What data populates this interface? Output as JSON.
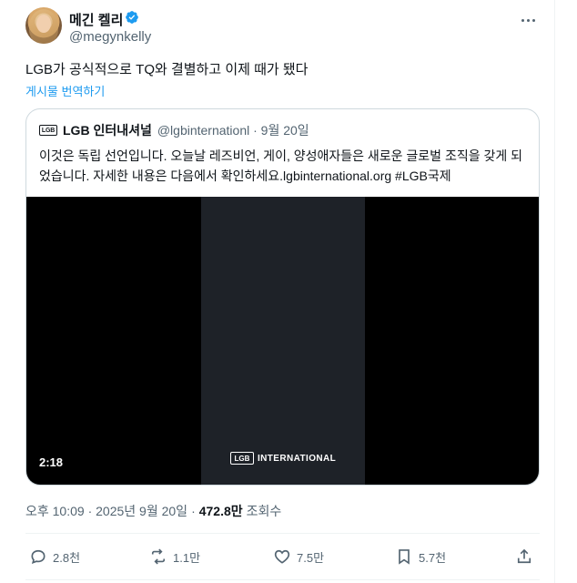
{
  "author": {
    "display_name": "메긴 켈리",
    "handle": "@megynkelly"
  },
  "tweet": {
    "text": "LGB가 공식적으로 TQ와 결별하고 이제 때가 됐다",
    "translate_label": "게시물 번역하기"
  },
  "quote": {
    "logo_text": "LGB",
    "name": "LGB 인터내셔널",
    "handle_date": "@lgbinternationl · 9월 20일",
    "body": "이것은 독립 선언입니다. 오늘날 레즈비언, 게이, 양성애자들은 새로운 글로벌 조직을 갖게 되었습니다. 자세한 내용은 다음에서 확인하세요.lgbinternational.org #LGB국제",
    "video": {
      "logo_box": "LGB",
      "logo_text": "INTERNATIONAL",
      "duration": "2:18"
    }
  },
  "meta": {
    "timestamp": "오후 10:09 · 2025년 9월 20일",
    "separator": "·",
    "views_count": "472.8만",
    "views_label": "조회수"
  },
  "actions": {
    "replies": "2.8천",
    "reposts": "1.1만",
    "likes": "7.5만",
    "bookmarks": "5.7천"
  },
  "icons": {
    "verified": "verified-badge-icon",
    "more": "more-icon",
    "reply": "reply-icon",
    "repost": "repost-icon",
    "like": "heart-icon",
    "bookmark": "bookmark-icon",
    "share": "share-icon"
  },
  "colors": {
    "accent": "#1d9bf0",
    "text": "#0f1419",
    "secondary": "#536471",
    "border": "#cfd9de"
  }
}
